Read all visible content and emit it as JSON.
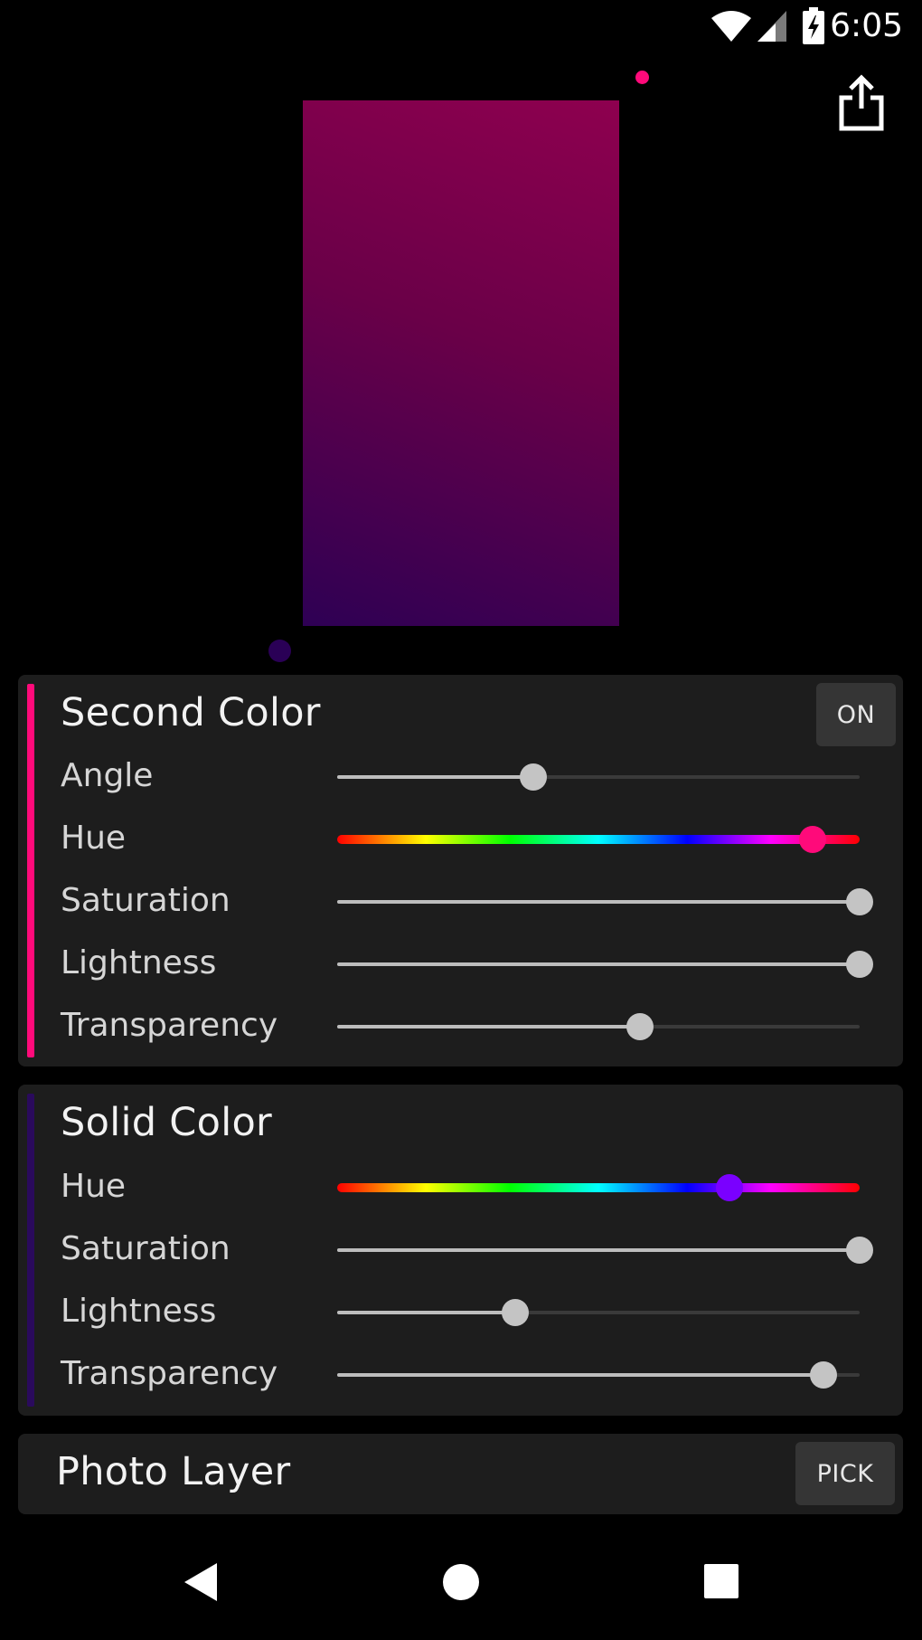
{
  "status_bar": {
    "time": "6:05",
    "icons": [
      "wifi-icon",
      "cell-signal-icon",
      "battery-charging-icon"
    ]
  },
  "preview": {
    "colors": {
      "top": "#8e004f",
      "bottom": "#2e0054"
    },
    "handles": [
      {
        "name": "second-color-handle",
        "color": "#ff0a7a"
      },
      {
        "name": "solid-color-handle",
        "color": "#2a0056"
      }
    ],
    "share_icon": "share-icon"
  },
  "second_color": {
    "title": "Second Color",
    "toggle_label": "ON",
    "accent_color": "#ff0a7a",
    "sliders": [
      {
        "label": "Angle",
        "value": 0.375,
        "type": "plain"
      },
      {
        "label": "Hue",
        "value": 0.91,
        "type": "hue",
        "thumb_color": "#ff0a7a"
      },
      {
        "label": "Saturation",
        "value": 1.0,
        "type": "plain"
      },
      {
        "label": "Lightness",
        "value": 1.0,
        "type": "plain"
      },
      {
        "label": "Transparency",
        "value": 0.58,
        "type": "plain"
      }
    ]
  },
  "solid_color": {
    "title": "Solid Color",
    "accent_color": "#2a0a5c",
    "sliders": [
      {
        "label": "Hue",
        "value": 0.75,
        "type": "hue",
        "thumb_color": "#7a00ff"
      },
      {
        "label": "Saturation",
        "value": 1.0,
        "type": "plain"
      },
      {
        "label": "Lightness",
        "value": 0.34,
        "type": "plain"
      },
      {
        "label": "Transparency",
        "value": 0.93,
        "type": "plain"
      }
    ]
  },
  "photo_layer": {
    "title": "Photo Layer",
    "button_label": "PICK"
  },
  "nav_bar": {
    "icons": [
      "back-icon",
      "home-icon",
      "recents-icon"
    ]
  }
}
